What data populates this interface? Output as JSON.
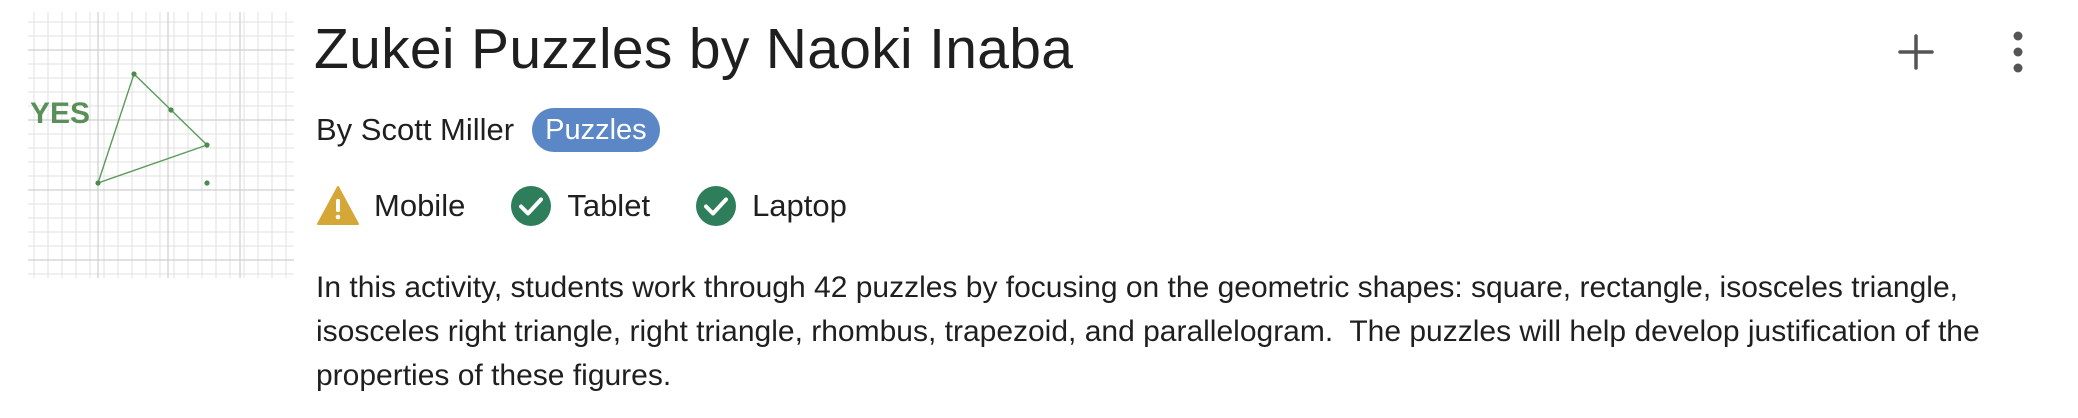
{
  "activity": {
    "title": "Zukei Puzzles by Naoki Inaba",
    "author": "By Scott Miller",
    "tag": "Puzzles",
    "thumbnail": {
      "answer_text": "YES",
      "answer_color": "#5a8f5a",
      "grid_color": "#e2e2e2",
      "shape_color": "#5a9a5a"
    },
    "devices": [
      {
        "label": "Mobile",
        "status": "warning",
        "icon": "warning-icon",
        "color": "#d4a736"
      },
      {
        "label": "Tablet",
        "status": "supported",
        "icon": "check-circle-icon",
        "color": "#2e7d5b"
      },
      {
        "label": "Laptop",
        "status": "supported",
        "icon": "check-circle-icon",
        "color": "#2e7d5b"
      }
    ],
    "description": "In this activity, students work through 42 puzzles by focusing on the geometric shapes: square, rectangle, isosceles triangle, isosceles right triangle, right triangle, rhombus, trapezoid, and parallelogram.  The puzzles will help develop justification of the properties of these figures."
  },
  "actions": {
    "add_icon": "plus-icon",
    "more_icon": "more-vertical-icon"
  },
  "colors": {
    "tag_background": "#5b87c7",
    "text": "#1f1f1f",
    "icon_gray": "#555555"
  }
}
